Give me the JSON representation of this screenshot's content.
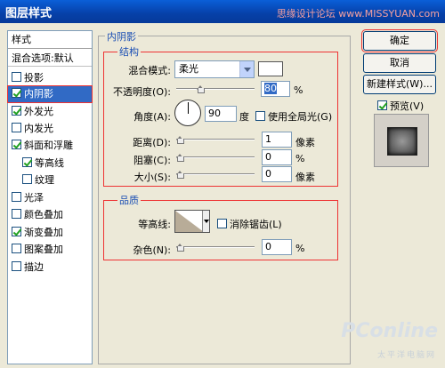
{
  "window": {
    "title": "图层样式",
    "watermark": "思缘设计论坛 www.MISSYUAN.com"
  },
  "left_panel": {
    "header": "样式",
    "blend_options": "混合选项:默认",
    "items": [
      {
        "label": "投影",
        "checked": false
      },
      {
        "label": "内阴影",
        "checked": true,
        "selected": true
      },
      {
        "label": "外发光",
        "checked": true
      },
      {
        "label": "内发光",
        "checked": false
      },
      {
        "label": "斜面和浮雕",
        "checked": true
      },
      {
        "label": "等高线",
        "checked": true,
        "sub": true
      },
      {
        "label": "纹理",
        "checked": false,
        "sub": true
      },
      {
        "label": "光泽",
        "checked": false
      },
      {
        "label": "颜色叠加",
        "checked": false
      },
      {
        "label": "渐变叠加",
        "checked": true
      },
      {
        "label": "图案叠加",
        "checked": false
      },
      {
        "label": "描边",
        "checked": false
      }
    ]
  },
  "inner_shadow": {
    "section_title": "内阴影",
    "structure": {
      "title": "结构",
      "blend_mode_label": "混合模式:",
      "blend_mode_value": "柔光",
      "opacity_label": "不透明度(O):",
      "opacity_value": "80",
      "opacity_unit": "%",
      "opacity_level": 0.8,
      "angle_label": "角度(A):",
      "angle_value": "90",
      "angle_unit": "度",
      "global_light_label": "使用全局光(G)",
      "distance_label": "距离(D):",
      "distance_value": "1",
      "distance_unit": "像素",
      "choke_label": "阻塞(C):",
      "choke_value": "0",
      "choke_unit": "%",
      "size_label": "大小(S):",
      "size_value": "0",
      "size_unit": "像素"
    },
    "quality": {
      "title": "品质",
      "contour_label": "等高线:",
      "anti_alias_label": "消除锯齿(L)",
      "noise_label": "杂色(N):",
      "noise_value": "0",
      "noise_unit": "%"
    }
  },
  "buttons": {
    "ok": "确定",
    "cancel": "取消",
    "new_style": "新建样式(W)...",
    "preview": "预览(V)"
  },
  "brand": {
    "name": "PConline",
    "sub": "太平洋电脑网"
  },
  "colors": {
    "title_bar": "#0a5fd8",
    "selection": "#316ac5",
    "highlight_box": "#e33333",
    "legend_text": "#1b4fb4"
  }
}
